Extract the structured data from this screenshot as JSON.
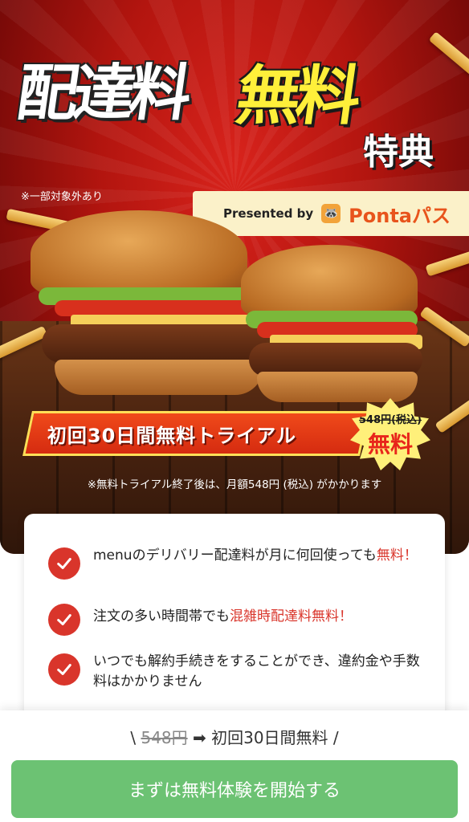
{
  "hero": {
    "title_main": "配達料",
    "title_free": "無料",
    "title_perk": "特典",
    "note": "※一部対象外あり",
    "presented_by": "Presented by",
    "partner_name": "Pontaパス",
    "partner_icon": "ponta-raccoon-icon",
    "trial_banner": "初回30日間無料トライアル",
    "badge_price": "548円(税込)",
    "badge_free": "無料",
    "trial_note": "※無料トライアル終了後は、月額548円 (税込) がかかります"
  },
  "features": [
    {
      "text": "menuのデリバリー配達料が月に何回使っても",
      "highlight": "無料！"
    },
    {
      "text": "注文の多い時間帯でも",
      "highlight": "混雑時配達料無料！"
    },
    {
      "text": "いつでも解約手続きをすることができ、違約金や手数料はかかりません",
      "highlight": ""
    }
  ],
  "bottom": {
    "prefix": "\\",
    "old_price": "548円",
    "arrow": "➡",
    "new_offer": "初回30日間無料",
    "suffix": "/",
    "cta_label": "まずは無料体験を開始する"
  },
  "colors": {
    "hero_red": "#b3150f",
    "accent_red": "#d9352b",
    "title_yellow": "#ffef3a",
    "cta_green": "#6cc273",
    "partner_orange": "#e8541c"
  }
}
